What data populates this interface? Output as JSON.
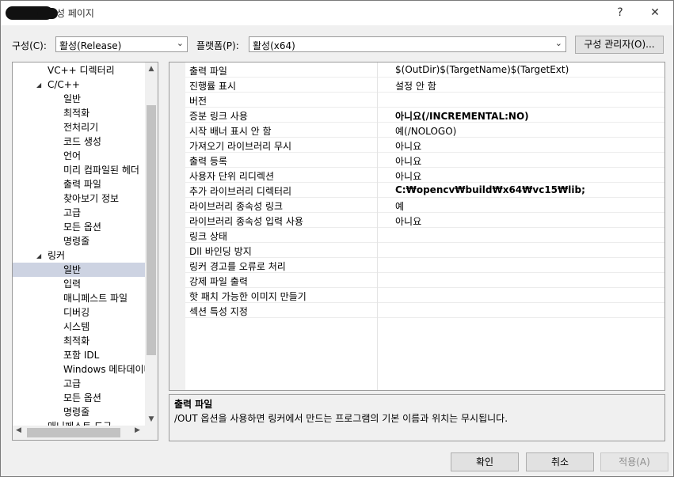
{
  "window": {
    "title": "성 페이지",
    "help": "?",
    "close": "✕"
  },
  "config": {
    "label": "구성(C):",
    "value": "활성(Release)",
    "platform_label": "플랫폼(P):",
    "platform_value": "활성(x64)",
    "manager_button": "구성 관리자(O)..."
  },
  "tree": {
    "items": [
      {
        "label": "VC++ 디렉터리",
        "indent": 1
      },
      {
        "label": "C/C++",
        "indent": 1,
        "expanded": true
      },
      {
        "label": "일반",
        "indent": 2
      },
      {
        "label": "최적화",
        "indent": 2
      },
      {
        "label": "전처리기",
        "indent": 2
      },
      {
        "label": "코드 생성",
        "indent": 2
      },
      {
        "label": "언어",
        "indent": 2
      },
      {
        "label": "미리 컴파일된 헤더",
        "indent": 2
      },
      {
        "label": "출력 파일",
        "indent": 2
      },
      {
        "label": "찾아보기 정보",
        "indent": 2
      },
      {
        "label": "고급",
        "indent": 2
      },
      {
        "label": "모든 옵션",
        "indent": 2
      },
      {
        "label": "명령줄",
        "indent": 2
      },
      {
        "label": "링커",
        "indent": 1,
        "expanded": true
      },
      {
        "label": "일반",
        "indent": 2,
        "selected": true
      },
      {
        "label": "입력",
        "indent": 2
      },
      {
        "label": "매니페스트 파일",
        "indent": 2
      },
      {
        "label": "디버깅",
        "indent": 2
      },
      {
        "label": "시스템",
        "indent": 2
      },
      {
        "label": "최적화",
        "indent": 2
      },
      {
        "label": "포함 IDL",
        "indent": 2
      },
      {
        "label": "Windows 메타데이터",
        "indent": 2
      },
      {
        "label": "고급",
        "indent": 2
      },
      {
        "label": "모든 옵션",
        "indent": 2
      },
      {
        "label": "명령줄",
        "indent": 2
      },
      {
        "label": "매니페스트 도구",
        "indent": 1
      }
    ]
  },
  "properties": {
    "rows": [
      {
        "name": "출력 파일",
        "value": "$(OutDir)$(TargetName)$(TargetExt)",
        "bold": false
      },
      {
        "name": "진행률 표시",
        "value": "설정 안 함",
        "bold": false
      },
      {
        "name": "버전",
        "value": "",
        "bold": false
      },
      {
        "name": "증분 링크 사용",
        "value": "아니요(/INCREMENTAL:NO)",
        "bold": true
      },
      {
        "name": "시작 배너 표시 안 함",
        "value": "예(/NOLOGO)",
        "bold": false
      },
      {
        "name": "가져오기 라이브러리 무시",
        "value": "아니요",
        "bold": false
      },
      {
        "name": "출력 등록",
        "value": "아니요",
        "bold": false
      },
      {
        "name": "사용자 단위 리디렉션",
        "value": "아니요",
        "bold": false
      },
      {
        "name": "추가 라이브러리 디렉터리",
        "value": "C:₩opencv₩build₩x64₩vc15₩lib;",
        "bold": true
      },
      {
        "name": "라이브러리 종속성 링크",
        "value": "예",
        "bold": false
      },
      {
        "name": "라이브러리 종속성 입력 사용",
        "value": "아니요",
        "bold": false
      },
      {
        "name": "링크 상태",
        "value": "",
        "bold": false
      },
      {
        "name": "Dll 바인딩 방지",
        "value": "",
        "bold": false
      },
      {
        "name": "링커 경고를 오류로 처리",
        "value": "",
        "bold": false
      },
      {
        "name": "강제 파일 출력",
        "value": "",
        "bold": false
      },
      {
        "name": "핫 패치 가능한 이미지 만들기",
        "value": "",
        "bold": false
      },
      {
        "name": "섹션 특성 지정",
        "value": "",
        "bold": false
      }
    ]
  },
  "description": {
    "title": "출력 파일",
    "body": "/OUT 옵션을 사용하면 링커에서 만드는 프로그램의 기본 이름과 위치는 무시됩니다."
  },
  "buttons": {
    "ok": "확인",
    "cancel": "취소",
    "apply": "적용(A)"
  }
}
